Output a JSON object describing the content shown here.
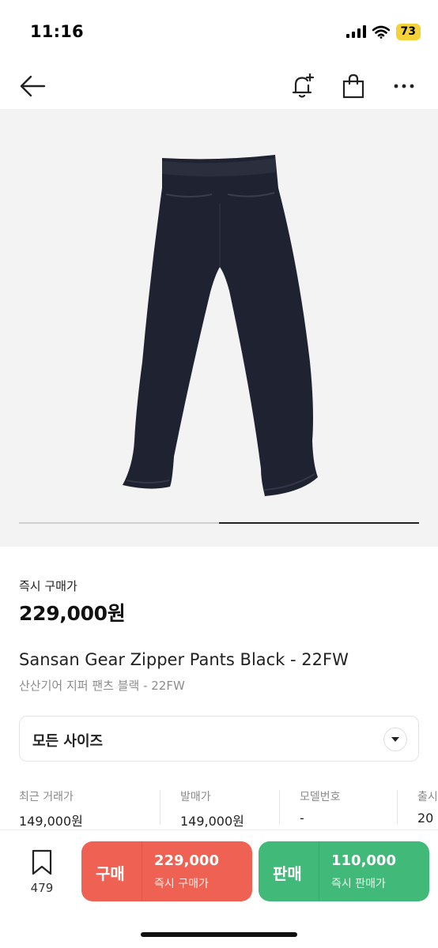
{
  "status_bar": {
    "time": "11:16",
    "battery": "73",
    "battery_color": "#f5d23a"
  },
  "nav": {
    "back_icon": "arrow-left-icon",
    "alert_icon": "bell-plus-icon",
    "bag_icon": "shopping-bag-icon",
    "more_icon": "more-horizontal-icon"
  },
  "gallery": {
    "image_subject": "black-pants",
    "current_page": 2,
    "page_count": 2
  },
  "product": {
    "price_label": "즉시 구매가",
    "price": "229,000원",
    "name": "Sansan Gear Zipper Pants Black - 22FW",
    "name_ko": "산산기어 지퍼 팬츠 블랙 - 22FW"
  },
  "size_select": {
    "label": "모든 사이즈",
    "icon": "chevron-down-icon"
  },
  "stats": [
    {
      "label": "최근 거래가",
      "value": "149,000원"
    },
    {
      "label": "발매가",
      "value": "149,000원"
    },
    {
      "label": "모델번호",
      "value": "-"
    },
    {
      "label": "출시",
      "value": "20"
    }
  ],
  "bottom_bar": {
    "wish_icon": "bookmark-icon",
    "wish_count": "479",
    "buy": {
      "label": "구매",
      "price": "229,000",
      "sub": "즉시 구매가",
      "color": "#ef6253"
    },
    "sell": {
      "label": "판매",
      "price": "110,000",
      "sub": "즉시 판매가",
      "color": "#41b979"
    }
  }
}
